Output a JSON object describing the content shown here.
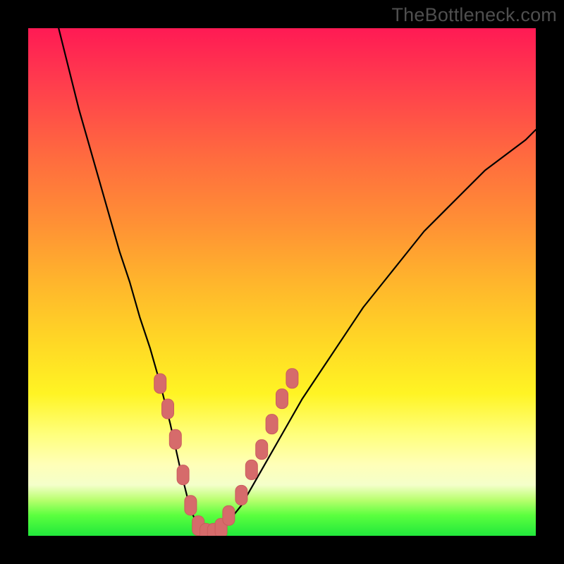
{
  "watermark": "TheBottleneck.com",
  "colors": {
    "frame": "#000000",
    "curve": "#000000",
    "marker_fill": "#d66b6b",
    "marker_stroke": "#c95d5d"
  },
  "chart_data": {
    "type": "line",
    "title": "",
    "xlabel": "",
    "ylabel": "",
    "xlim": [
      0,
      100
    ],
    "ylim": [
      0,
      100
    ],
    "series": [
      {
        "name": "bottleneck-curve",
        "x": [
          6,
          8,
          10,
          12,
          14,
          16,
          18,
          20,
          22,
          24,
          26,
          28,
          30,
          32,
          34,
          36,
          38,
          42,
          46,
          50,
          54,
          58,
          62,
          66,
          70,
          74,
          78,
          82,
          86,
          90,
          94,
          98,
          100
        ],
        "y": [
          100,
          92,
          84,
          77,
          70,
          63,
          56,
          50,
          43,
          37,
          30,
          22,
          13,
          5,
          1,
          0,
          1,
          6,
          13,
          20,
          27,
          33,
          39,
          45,
          50,
          55,
          60,
          64,
          68,
          72,
          75,
          78,
          80
        ]
      }
    ],
    "markers": {
      "name": "highlight-dots",
      "points": [
        {
          "x": 26,
          "y": 30
        },
        {
          "x": 27.5,
          "y": 25
        },
        {
          "x": 29,
          "y": 19
        },
        {
          "x": 30.5,
          "y": 12
        },
        {
          "x": 32,
          "y": 6
        },
        {
          "x": 33.5,
          "y": 2
        },
        {
          "x": 35,
          "y": 0.5
        },
        {
          "x": 36.5,
          "y": 0.5
        },
        {
          "x": 38,
          "y": 1.5
        },
        {
          "x": 39.5,
          "y": 4
        },
        {
          "x": 42,
          "y": 8
        },
        {
          "x": 44,
          "y": 13
        },
        {
          "x": 46,
          "y": 17
        },
        {
          "x": 48,
          "y": 22
        },
        {
          "x": 50,
          "y": 27
        },
        {
          "x": 52,
          "y": 31
        }
      ]
    }
  }
}
